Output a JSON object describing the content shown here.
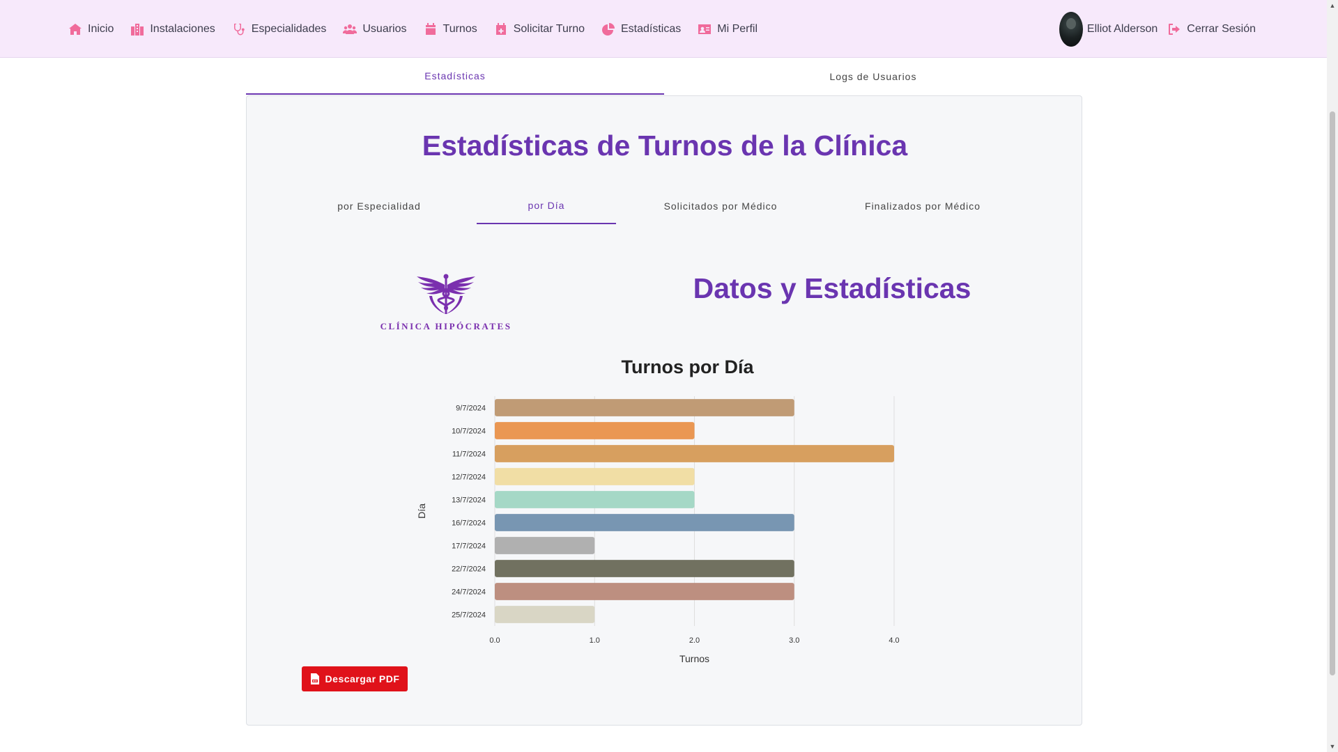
{
  "navbar": {
    "items": [
      {
        "label": "Inicio",
        "icon": "home-icon"
      },
      {
        "label": "Instalaciones",
        "icon": "building-icon"
      },
      {
        "label": "Especialidades",
        "icon": "stethoscope-icon"
      },
      {
        "label": "Usuarios",
        "icon": "users-icon"
      },
      {
        "label": "Turnos",
        "icon": "calendar-icon"
      },
      {
        "label": "Solicitar Turno",
        "icon": "calendar-plus-icon"
      },
      {
        "label": "Estadísticas",
        "icon": "pie-chart-icon"
      },
      {
        "label": "Mi Perfil",
        "icon": "id-card-icon"
      }
    ],
    "user_name": "Elliot Alderson",
    "logout_label": "Cerrar Sesión",
    "accent_color": "#f06b9b"
  },
  "main_tabs": [
    {
      "label": "Estadísticas",
      "active": true
    },
    {
      "label": "Logs de Usuarios",
      "active": false
    }
  ],
  "card": {
    "title": "Estadísticas de Turnos de la Clínica",
    "sub_tabs": [
      {
        "label": "por Especialidad",
        "active": false
      },
      {
        "label": "por Día",
        "active": true
      },
      {
        "label": "Solicitados por Médico",
        "active": false
      },
      {
        "label": "Finalizados por Médico",
        "active": false
      }
    ],
    "logo_text": "CLÍNICA HIPÓCRATES",
    "section_title": "Datos y Estadísticas",
    "pdf_button_label": "Descargar PDF"
  },
  "chart_data": {
    "type": "bar",
    "orientation": "horizontal",
    "title": "Turnos por Día",
    "xlabel": "Turnos",
    "ylabel": "Día",
    "xlim": [
      0,
      4
    ],
    "x_ticks": [
      "0.0",
      "1.0",
      "2.0",
      "3.0",
      "4.0"
    ],
    "grid": true,
    "categories": [
      "9/7/2024",
      "10/7/2024",
      "11/7/2024",
      "12/7/2024",
      "13/7/2024",
      "16/7/2024",
      "17/7/2024",
      "22/7/2024",
      "24/7/2024",
      "25/7/2024"
    ],
    "values": [
      3,
      2,
      4,
      2,
      2,
      3,
      1,
      3,
      3,
      1
    ],
    "colors": [
      "#c09b75",
      "#ea9753",
      "#d79f5f",
      "#f1dea5",
      "#a5d8c6",
      "#7896b2",
      "#b0b0b0",
      "#717160",
      "#bd8f80",
      "#d9d6c5"
    ]
  }
}
